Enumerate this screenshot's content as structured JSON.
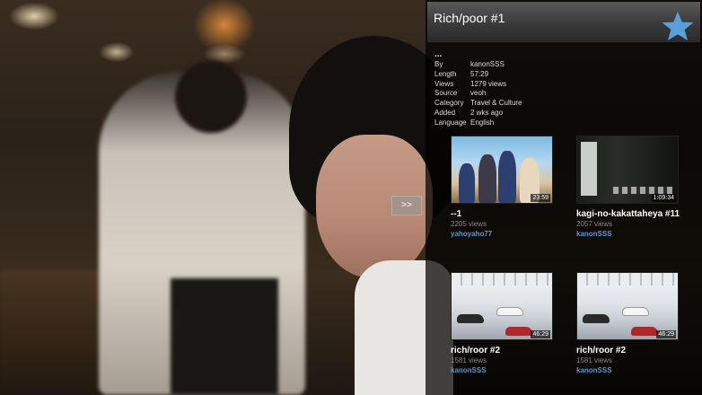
{
  "player": {
    "expand_label": ">>"
  },
  "panel": {
    "title": "Rich/poor #1",
    "info_dots": "...",
    "info": [
      {
        "key": "By",
        "value": "kanonSSS"
      },
      {
        "key": "Length",
        "value": "57:29"
      },
      {
        "key": "Views",
        "value": "1279 views"
      },
      {
        "key": "Source",
        "value": "veoh"
      },
      {
        "key": "Category",
        "value": "Travel & Culture"
      },
      {
        "key": "Added",
        "value": "2 wks ago"
      },
      {
        "key": "Language",
        "value": "English"
      }
    ],
    "related": [
      {
        "title": "--1",
        "views": "2205 views",
        "user": "yahoyaho77",
        "duration": "23:59"
      },
      {
        "title": "kagi-no-kakattaheya #11",
        "views": "2057 views",
        "user": "kanonSSS",
        "duration": "1:09:34"
      },
      {
        "title": "rich/roor #2",
        "views": "1581 views",
        "user": "kanonSSS",
        "duration": "46:29"
      },
      {
        "title": "rich/roor #2",
        "views": "1581 views",
        "user": "kanonSSS",
        "duration": "46:29"
      }
    ]
  },
  "icons": {
    "favorite": "star-icon"
  },
  "colors": {
    "accent": "#4e9bd6",
    "star": "#5aa0d8"
  }
}
